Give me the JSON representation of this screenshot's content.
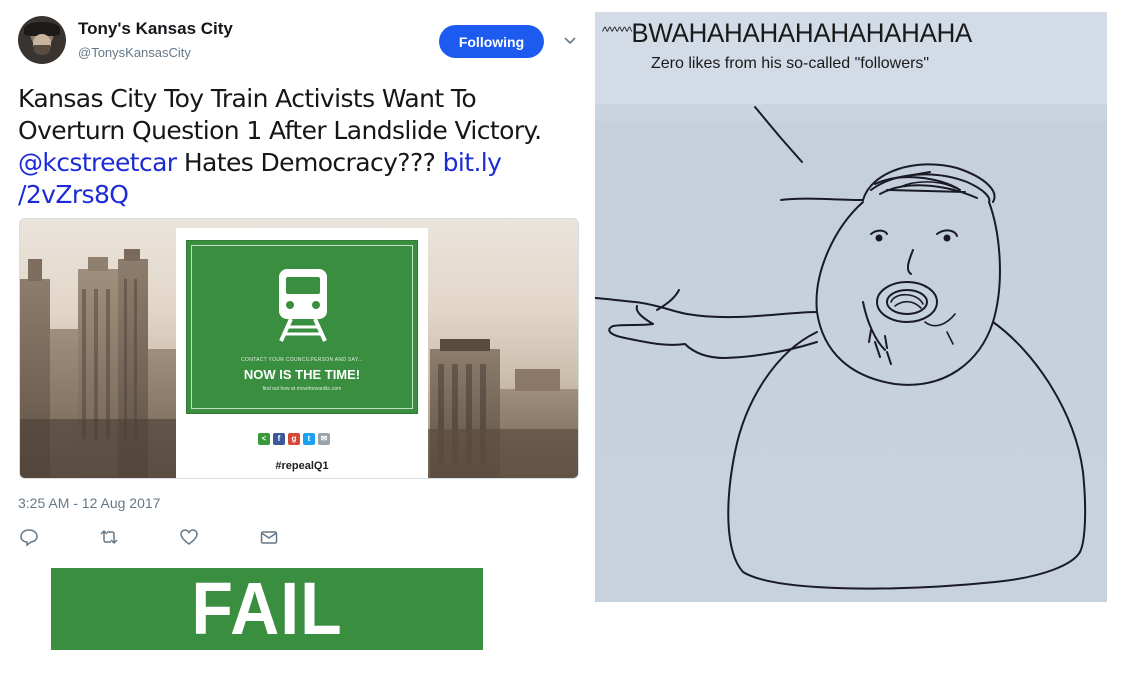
{
  "tweet": {
    "name": "Tony's Kansas City",
    "handle": "@TonysKansasCity",
    "follow_label": "Following",
    "text_part1": "Kansas City Toy Train Activists Want To Overturn Question 1 After Landslide Victory. ",
    "mention": "@kcstreetcar",
    "text_part2": " Hates Democracy??? ",
    "link_line1": "bit.ly",
    "link_line2": "/2vZrs8Q",
    "timestamp": "3:25 AM - 12 Aug 2017",
    "poster": {
      "small_text": "CONTACT YOUR COUNCILPERSON AND SAY...",
      "headline": "NOW IS THE TIME!",
      "url_text": "find out how at moveforwardkc.com",
      "hashtag": "#repealQ1"
    },
    "icons": {
      "reply": "reply-icon",
      "retweet": "retweet-icon",
      "like": "heart-icon",
      "dm": "envelope-icon",
      "more": "chevron-down-icon"
    },
    "colors": {
      "follow_button": "#1d5bf0",
      "link": "#1c2bd6",
      "poster_green": "#3a8e40"
    }
  },
  "fail_banner": {
    "text": "FAIL",
    "color": "#3a8e40"
  },
  "drawing": {
    "header_prefix": "^^^^^^",
    "header": "BWAHAHAHAHAHAHAHAHA",
    "caption": "Zero likes from his so-called \"followers\""
  }
}
